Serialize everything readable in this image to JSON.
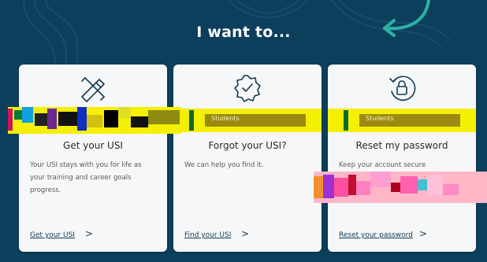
{
  "heading": "I want to...",
  "cards": [
    {
      "icon": "pencil-ruler-icon",
      "tag": "",
      "title": "Get your USI",
      "desc": "Your USI stays with you for life as your training and career goals progress.",
      "link": "Get your USI",
      "arrow": ">"
    },
    {
      "icon": "check-badge-icon",
      "tag": "Students",
      "title": "Forgot your USI?",
      "desc": "We can help you find it.",
      "link": "Find your USI",
      "arrow": ">"
    },
    {
      "icon": "lock-reset-icon",
      "tag": "Students",
      "title": "Reset my password",
      "desc": "Keep your account secure",
      "link": "Reset your password",
      "arrow": ">"
    }
  ],
  "colors": {
    "background": "#0c3f5c",
    "card": "#f6f7f8",
    "highlight": "#f5f000",
    "accent": "#2bb3a5"
  }
}
